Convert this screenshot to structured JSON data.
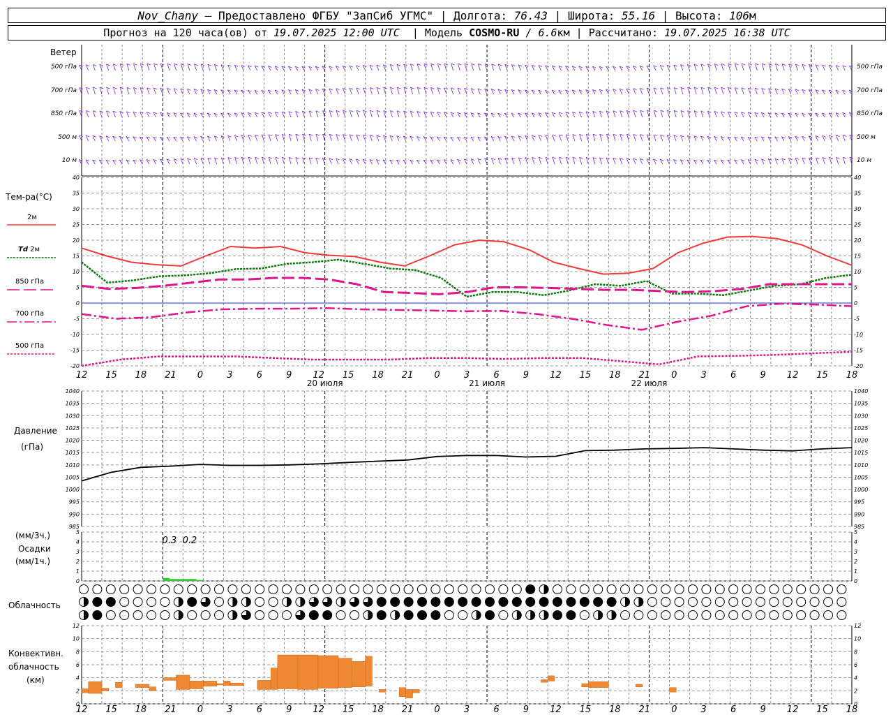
{
  "header": {
    "station": "Nov_Chany",
    "provider": "— Предоставлено ФГБУ \"ЗапСиб УГМС\"",
    "lon_label": "| Долгота:",
    "lon": "76.43",
    "lat_label": "| Широта:",
    "lat": "55.16",
    "alt_label": "| Высота:",
    "alt": "106",
    "alt_unit": "м",
    "forecast_label": "Прогноз на 120 часа(ов) от",
    "forecast_start": "19.07.2025 12:00 UTC",
    "model_label": "| Модель",
    "model": "COSMO-RU",
    "resolution": "/ 6.6",
    "res_unit": "км",
    "calc_label": "| Рассчитано:",
    "calc_time": "19.07.2025 16:38 UTC"
  },
  "labels": {
    "wind": "Ветер",
    "wind_levels": [
      "500 гПа",
      "700 гПа",
      "850 гПа",
      "500 м",
      "10 м"
    ],
    "temp": "Тем-ра(°C)",
    "t2m": "2м",
    "td": "Td",
    "td2m": "2м",
    "t850": "850 гПа",
    "t700": "700 гПа",
    "t500": "500 гПа",
    "pressure": "Давление",
    "pressure_unit": "(гПа)",
    "precip_u1": "(мм/3ч.)",
    "precip": "Осадки",
    "precip_u2": "(мм/1ч.)",
    "clouds": "Облачность",
    "conv1": "Конвективн.",
    "conv2": "облачность",
    "conv3": "(км)"
  },
  "time_ticks": [
    "12",
    "15",
    "18",
    "21",
    "0",
    "3",
    "6",
    "9",
    "12",
    "15",
    "18",
    "21",
    "0",
    "3",
    "6",
    "9",
    "12",
    "15",
    "18",
    "21",
    "0",
    "3",
    "6",
    "9",
    "12",
    "15",
    "18"
  ],
  "dates": [
    "20 июля",
    "21 июля",
    "22 июля"
  ],
  "colors": {
    "wind": "#7b22e6",
    "t2m": "#ee3a3a",
    "td": "#0a7a0a",
    "t850": "#e0148c",
    "precip": "#33cc33",
    "conv": "#ee8833",
    "zero": "#2233cc"
  },
  "precip_labels": [
    {
      "hour": 13,
      "text": "0.3"
    },
    {
      "hour": 16,
      "text": "0.2"
    }
  ],
  "chart_data": [
    {
      "type": "line",
      "name": "temperature",
      "x_hours": [
        0,
        3,
        6,
        9,
        12,
        15,
        18,
        21,
        24,
        27,
        30,
        33,
        36,
        39,
        42,
        45,
        48,
        51,
        54,
        57,
        60,
        63,
        66,
        69,
        72,
        75,
        78,
        81,
        84,
        87,
        90,
        93,
        96,
        99,
        102,
        105,
        108,
        111,
        114
      ],
      "ylim": [
        -20,
        40
      ],
      "yticks": [
        -20,
        -15,
        -10,
        -5,
        0,
        5,
        10,
        15,
        20,
        25,
        30,
        35,
        40
      ],
      "series": [
        {
          "name": "2м",
          "values": [
            17.5,
            15,
            13,
            12.2,
            11.8,
            15,
            18,
            17.5,
            18,
            16,
            15.2,
            14.8,
            13,
            11.8,
            15,
            18.5,
            20,
            19.5,
            17,
            13,
            11,
            9.2,
            9.5,
            11,
            16,
            19,
            21,
            21.2,
            20.5,
            18.5,
            15,
            12
          ]
        },
        {
          "name": "Td 2м",
          "values": [
            13,
            6.5,
            7.2,
            8.5,
            8.8,
            9.5,
            10.8,
            11,
            12.5,
            13,
            13.8,
            12.5,
            11,
            10.5,
            8,
            2,
            3.5,
            3.5,
            2.5,
            4,
            6,
            5.5,
            7,
            3,
            3,
            2.5,
            4,
            5.5,
            6,
            8,
            9
          ]
        },
        {
          "name": "850 гПа",
          "values": [
            5.5,
            4.5,
            4.8,
            5.5,
            6.5,
            7.5,
            7.5,
            8,
            8,
            7.5,
            6,
            3.5,
            3.2,
            2.8,
            3.5,
            5,
            5,
            4.8,
            4.5,
            4.2,
            4.2,
            3.8,
            3.5,
            3.8,
            4.5,
            6,
            6,
            6,
            6
          ]
        },
        {
          "name": "700 гПа",
          "values": [
            -3.5,
            -5,
            -4.5,
            -3,
            -2,
            -1.8,
            -1.8,
            -1.6,
            -2,
            -2.2,
            -2.4,
            -2.6,
            -2.5,
            -3.5,
            -5,
            -7,
            -8.5,
            -6,
            -4,
            -1,
            -0.2,
            -0.5,
            -1
          ]
        },
        {
          "name": "500 гПа",
          "values": [
            -20,
            -18,
            -17,
            -17,
            -17,
            -17.5,
            -18,
            -18,
            -18,
            -17.5,
            -17.5,
            -17.8,
            -17.5,
            -17.5,
            -18.5,
            -19.5,
            -17,
            -16.8,
            -16.5,
            -16,
            -15.5
          ]
        }
      ]
    },
    {
      "type": "line",
      "name": "pressure",
      "ylim": [
        985,
        1040
      ],
      "yticks": [
        985,
        990,
        995,
        1000,
        1005,
        1010,
        1015,
        1020,
        1025,
        1030,
        1035,
        1040
      ],
      "x_hours": [
        0,
        3,
        6,
        9,
        12,
        15,
        18,
        21,
        24,
        27,
        30,
        33,
        36,
        39,
        42,
        45,
        48,
        51,
        54,
        57,
        60,
        63,
        66,
        69,
        72,
        75,
        78,
        81,
        84,
        87,
        90,
        93,
        96,
        99,
        102,
        105,
        108,
        111,
        114
      ],
      "series": [
        {
          "name": "",
          "values": [
            1003.5,
            1007,
            1009,
            1009.5,
            1010.2,
            1009.8,
            1009.8,
            1010,
            1010.4,
            1011,
            1011.5,
            1012,
            1013.4,
            1013.8,
            1013.8,
            1013.2,
            1013.5,
            1015.8,
            1016,
            1016.5,
            1016.7,
            1017,
            1016.5,
            1016,
            1015.7,
            1016.5,
            1017
          ]
        }
      ]
    },
    {
      "type": "bar",
      "name": "precipitation",
      "ylim": [
        0,
        5
      ],
      "bars": [
        {
          "hour": 12,
          "mm_1h": 0.3
        },
        {
          "hour": 13,
          "mm_1h": 0.2
        },
        {
          "hour": 14,
          "mm_1h": 0.2
        },
        {
          "hour": 15,
          "mm_1h": 0.2
        },
        {
          "hour": 16,
          "mm_1h": 0.2
        },
        {
          "hour": 17,
          "mm_1h": 0.1
        }
      ]
    },
    {
      "type": "bar",
      "name": "convective_cloud",
      "ylim": [
        0,
        12
      ],
      "segments_km": [
        {
          "h0": 0,
          "h1": 1,
          "bot": 1.7,
          "top": 2.3
        },
        {
          "h0": 1,
          "h1": 3,
          "bot": 1.6,
          "top": 3.4
        },
        {
          "h0": 3,
          "h1": 4,
          "bot": 2,
          "top": 2.4
        },
        {
          "h0": 5,
          "h1": 6,
          "bot": 2.5,
          "top": 3.3
        },
        {
          "h0": 8,
          "h1": 10,
          "bot": 2.5,
          "top": 3
        },
        {
          "h0": 10,
          "h1": 11,
          "bot": 2,
          "top": 2.6
        },
        {
          "h0": 12,
          "h1": 14,
          "bot": 3.6,
          "top": 4
        },
        {
          "h0": 14,
          "h1": 16,
          "bot": 2.2,
          "top": 4.4
        },
        {
          "h0": 16,
          "h1": 18,
          "bot": 2.3,
          "top": 3.5
        },
        {
          "h0": 18,
          "h1": 20,
          "bot": 2.7,
          "top": 3.5
        },
        {
          "h0": 20,
          "h1": 21,
          "bot": 2.9,
          "top": 3.1
        },
        {
          "h0": 21,
          "h1": 22,
          "bot": 2.8,
          "top": 3.5
        },
        {
          "h0": 22,
          "h1": 24,
          "bot": 2.8,
          "top": 3.2
        },
        {
          "h0": 26,
          "h1": 28,
          "bot": 2.2,
          "top": 3.6
        },
        {
          "h0": 28,
          "h1": 29,
          "bot": 2.2,
          "top": 5.5
        },
        {
          "h0": 29,
          "h1": 32,
          "bot": 2.3,
          "top": 7.5
        },
        {
          "h0": 32,
          "h1": 35,
          "bot": 2.2,
          "top": 7.5
        },
        {
          "h0": 35,
          "h1": 38,
          "bot": 2.4,
          "top": 7.4
        },
        {
          "h0": 38,
          "h1": 40,
          "bot": 2.5,
          "top": 7.0
        },
        {
          "h0": 40,
          "h1": 42,
          "bot": 2.6,
          "top": 6.5
        },
        {
          "h0": 42,
          "h1": 43,
          "bot": 2.7,
          "top": 7.3
        },
        {
          "h0": 44,
          "h1": 45,
          "bot": 1.8,
          "top": 2.2
        },
        {
          "h0": 47,
          "h1": 48,
          "bot": 1.1,
          "top": 2.5
        },
        {
          "h0": 48,
          "h1": 49,
          "bot": 0.9,
          "top": 2.2
        },
        {
          "h0": 49,
          "h1": 50,
          "bot": 1.7,
          "top": 2.2
        },
        {
          "h0": 68,
          "h1": 69,
          "bot": 3.3,
          "top": 3.7
        },
        {
          "h0": 69,
          "h1": 70,
          "bot": 3.5,
          "top": 4.3
        },
        {
          "h0": 74,
          "h1": 75,
          "bot": 2.6,
          "top": 3.1
        },
        {
          "h0": 75,
          "h1": 78,
          "bot": 2.5,
          "top": 3.4
        },
        {
          "h0": 82,
          "h1": 83,
          "bot": 2.6,
          "top": 3
        },
        {
          "h0": 87,
          "h1": 88,
          "bot": 1.8,
          "top": 2.5
        }
      ]
    }
  ]
}
